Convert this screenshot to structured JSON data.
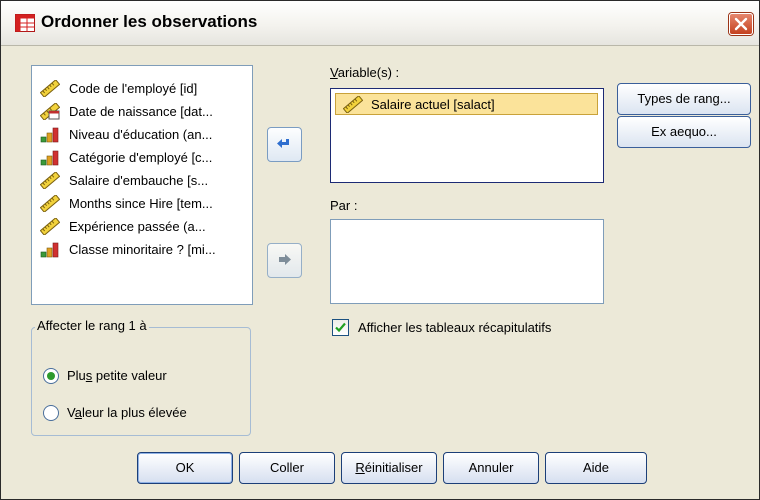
{
  "window": {
    "title": "Ordonner les observations"
  },
  "source_list": {
    "items": [
      {
        "label": "Code de l'employé [id]",
        "icon": "scale-icon"
      },
      {
        "label": "Date de naissance [dat...",
        "icon": "date-scale-icon"
      },
      {
        "label": "Niveau d'éducation (an...",
        "icon": "ordinal-bar-icon"
      },
      {
        "label": "Catégorie d'employé [c...",
        "icon": "ordinal-bar-icon"
      },
      {
        "label": "Salaire d'embauche [s...",
        "icon": "scale-icon"
      },
      {
        "label": "Months since Hire [tem...",
        "icon": "scale-icon"
      },
      {
        "label": "Expérience passée (a...",
        "icon": "scale-icon"
      },
      {
        "label": "Classe minoritaire ? [mi...",
        "icon": "ordinal-bar-icon"
      }
    ]
  },
  "variables": {
    "label_underlined": "V",
    "label_rest": "ariable(s) :",
    "items": [
      {
        "label": "Salaire actuel [salact]",
        "icon": "scale-icon"
      }
    ]
  },
  "par": {
    "label": "Par :"
  },
  "side_buttons": {
    "types_label": "Types de rang...",
    "ties_label": "Ex aequo..."
  },
  "summary_checkbox": {
    "label": "Afficher les tableaux récapitulatifs",
    "checked": true
  },
  "rank_group": {
    "legend": "Affecter le rang 1 à",
    "options": [
      {
        "pre": "Plu",
        "u": "s",
        "post": " petite valeur",
        "checked": true
      },
      {
        "pre": "V",
        "u": "a",
        "post": "leur la plus élevée",
        "checked": false
      }
    ]
  },
  "footer": {
    "ok": "OK",
    "paste": "Coller",
    "reset_u": "R",
    "reset_rest": "éinitialiser",
    "cancel": "Annuler",
    "help": "Aide"
  },
  "colors": {
    "accent": "#2f6fcf",
    "selection": "#fbe39a",
    "dialog_bg": "#ece9d8"
  }
}
